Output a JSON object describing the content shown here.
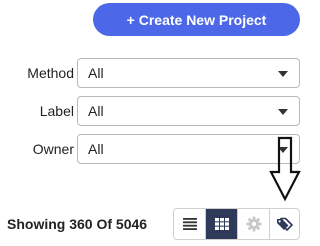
{
  "create_button": {
    "label": "+ Create New Project"
  },
  "filters": [
    {
      "label": "Method",
      "value": "All"
    },
    {
      "label": "Label",
      "value": "All"
    },
    {
      "label": "Owner",
      "value": "All"
    }
  ],
  "footer": {
    "count_text": "Showing 360 Of 5046"
  },
  "colors": {
    "primary": "#4c68e8",
    "active_view": "#2f3a5a"
  },
  "icons": {
    "list_view": "list-icon",
    "grid_view": "grid-icon",
    "settings": "gear-icon",
    "tags": "tags-icon",
    "annotation": "arrow-down-icon"
  }
}
